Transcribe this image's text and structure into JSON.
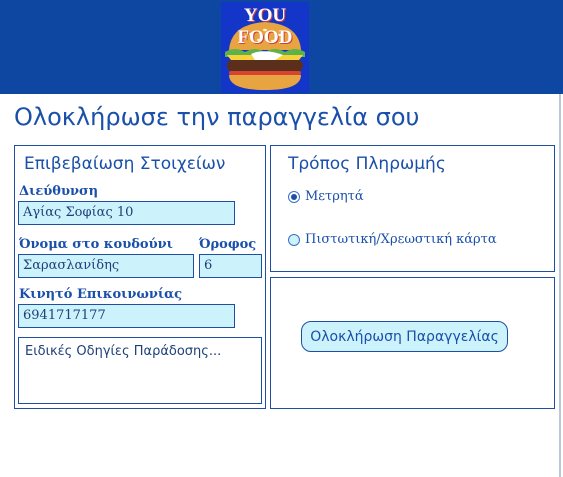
{
  "header": {
    "logo_text": "YOU FOOD",
    "bg_color": "#0d47a1"
  },
  "page": {
    "title": "Ολοκλήρωσε την παραγγελία σου"
  },
  "details": {
    "title": "Επιβεβαίωση Στοιχείων",
    "address_label": "Διεύθυνση",
    "address_value": "Αγίας Σοφίας 10",
    "doorbell_label": "Όνομα στο κουδούνι",
    "doorbell_value": "Σαρασλανίδης",
    "floor_label": "Όροφος",
    "floor_value": "6",
    "phone_label": "Κινητό Επικοινωνίας",
    "phone_value": "6941717177",
    "instructions_placeholder": "Ειδικές Οδηγίες Παράδοσης..."
  },
  "payment": {
    "title": "Τρόπος Πληρωμής",
    "options": [
      {
        "label": "Μετρητά",
        "selected": true
      },
      {
        "label": "Πιστωτική/Χρεωστική κάρτα",
        "selected": false
      }
    ]
  },
  "submit": {
    "label": "Ολοκλήρωση Παραγγελίας"
  },
  "colors": {
    "accent": "#1a4faa",
    "input_bg": "#ccf3fc"
  }
}
